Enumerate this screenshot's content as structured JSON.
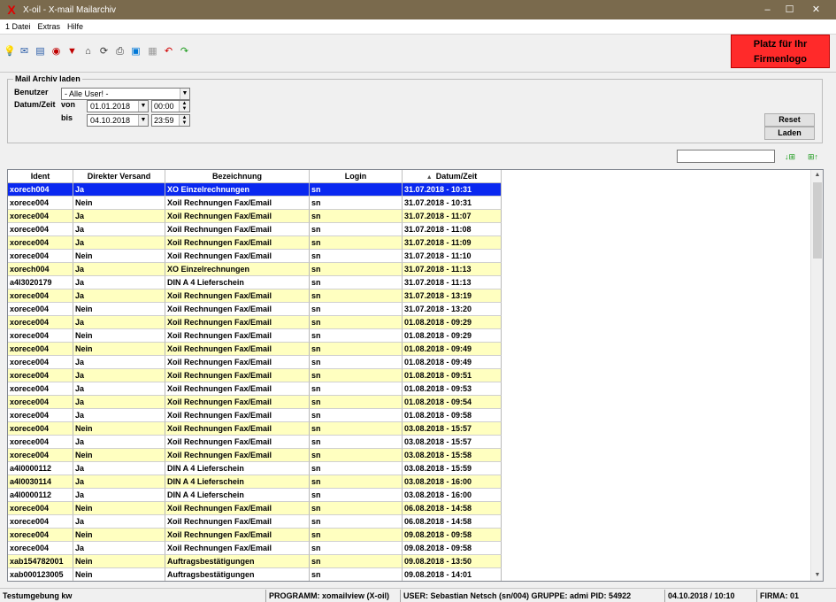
{
  "window": {
    "app_icon": "X",
    "title": "X-oil - X-mail Mailarchiv",
    "controls": [
      "–",
      "☐",
      "✕"
    ]
  },
  "menu": {
    "items": [
      "1 Datei",
      "Extras",
      "Hilfe"
    ]
  },
  "toolbar": {
    "icons": [
      "lightbulb-icon",
      "mail-icon",
      "book-icon",
      "database-icon",
      "filter-icon",
      "home-icon",
      "refresh-icon",
      "print-icon",
      "window-icon",
      "save-icon",
      "undo-icon",
      "redo-icon"
    ],
    "logo_line1": "Platz für Ihr",
    "logo_line2": "Firmenlogo"
  },
  "filter": {
    "group_title": "Mail Archiv laden",
    "benutzer_label": "Benutzer",
    "benutzer_value": "- Alle User! -",
    "datum_label": "Datum/Zeit",
    "von_label": "von",
    "bis_label": "bis",
    "von_date": "01.01.2018",
    "von_time": "00:00",
    "bis_date": "04.10.2018",
    "bis_time": "23:59",
    "reset_label": "Reset",
    "laden_label": "Laden"
  },
  "search": {
    "value": ""
  },
  "table": {
    "columns": [
      "Ident",
      "Direkter Versand",
      "Bezeichnung",
      "Login",
      "Datum/Zeit"
    ],
    "sort_indicator": "▲",
    "rows": [
      [
        "xorech004",
        "Ja",
        "XO Einzelrechnungen",
        "sn",
        "31.07.2018 - 10:31"
      ],
      [
        "xorece004",
        "Nein",
        "Xoil Rechnungen Fax/Email",
        "sn",
        "31.07.2018 - 10:31"
      ],
      [
        "xorece004",
        "Ja",
        "Xoil Rechnungen Fax/Email",
        "sn",
        "31.07.2018 - 11:07"
      ],
      [
        "xorece004",
        "Ja",
        "Xoil Rechnungen Fax/Email",
        "sn",
        "31.07.2018 - 11:08"
      ],
      [
        "xorece004",
        "Ja",
        "Xoil Rechnungen Fax/Email",
        "sn",
        "31.07.2018 - 11:09"
      ],
      [
        "xorece004",
        "Nein",
        "Xoil Rechnungen Fax/Email",
        "sn",
        "31.07.2018 - 11:10"
      ],
      [
        "xorech004",
        "Ja",
        "XO Einzelrechnungen",
        "sn",
        "31.07.2018 - 11:13"
      ],
      [
        "a4l3020179",
        "Ja",
        "DIN A 4 Lieferschein",
        "sn",
        "31.07.2018 - 11:13"
      ],
      [
        "xorece004",
        "Ja",
        "Xoil Rechnungen Fax/Email",
        "sn",
        "31.07.2018 - 13:19"
      ],
      [
        "xorece004",
        "Nein",
        "Xoil Rechnungen Fax/Email",
        "sn",
        "31.07.2018 - 13:20"
      ],
      [
        "xorece004",
        "Ja",
        "Xoil Rechnungen Fax/Email",
        "sn",
        "01.08.2018 - 09:29"
      ],
      [
        "xorece004",
        "Nein",
        "Xoil Rechnungen Fax/Email",
        "sn",
        "01.08.2018 - 09:29"
      ],
      [
        "xorece004",
        "Nein",
        "Xoil Rechnungen Fax/Email",
        "sn",
        "01.08.2018 - 09:49"
      ],
      [
        "xorece004",
        "Ja",
        "Xoil Rechnungen Fax/Email",
        "sn",
        "01.08.2018 - 09:49"
      ],
      [
        "xorece004",
        "Ja",
        "Xoil Rechnungen Fax/Email",
        "sn",
        "01.08.2018 - 09:51"
      ],
      [
        "xorece004",
        "Ja",
        "Xoil Rechnungen Fax/Email",
        "sn",
        "01.08.2018 - 09:53"
      ],
      [
        "xorece004",
        "Ja",
        "Xoil Rechnungen Fax/Email",
        "sn",
        "01.08.2018 - 09:54"
      ],
      [
        "xorece004",
        "Ja",
        "Xoil Rechnungen Fax/Email",
        "sn",
        "01.08.2018 - 09:58"
      ],
      [
        "xorece004",
        "Nein",
        "Xoil Rechnungen Fax/Email",
        "sn",
        "03.08.2018 - 15:57"
      ],
      [
        "xorece004",
        "Ja",
        "Xoil Rechnungen Fax/Email",
        "sn",
        "03.08.2018 - 15:57"
      ],
      [
        "xorece004",
        "Nein",
        "Xoil Rechnungen Fax/Email",
        "sn",
        "03.08.2018 - 15:58"
      ],
      [
        "a4l0000112",
        "Ja",
        "DIN A 4 Lieferschein",
        "sn",
        "03.08.2018 - 15:59"
      ],
      [
        "a4l0030114",
        "Ja",
        "DIN A 4 Lieferschein",
        "sn",
        "03.08.2018 - 16:00"
      ],
      [
        "a4l0000112",
        "Ja",
        "DIN A 4 Lieferschein",
        "sn",
        "03.08.2018 - 16:00"
      ],
      [
        "xorece004",
        "Nein",
        "Xoil Rechnungen Fax/Email",
        "sn",
        "06.08.2018 - 14:58"
      ],
      [
        "xorece004",
        "Ja",
        "Xoil Rechnungen Fax/Email",
        "sn",
        "06.08.2018 - 14:58"
      ],
      [
        "xorece004",
        "Nein",
        "Xoil Rechnungen Fax/Email",
        "sn",
        "09.08.2018 - 09:58"
      ],
      [
        "xorece004",
        "Ja",
        "Xoil Rechnungen Fax/Email",
        "sn",
        "09.08.2018 - 09:58"
      ],
      [
        "xab154782001",
        "Nein",
        "Auftragsbestätigungen",
        "sn",
        "09.08.2018 - 13:50"
      ],
      [
        "xab000123005",
        "Nein",
        "Auftragsbestätigungen",
        "sn",
        "09.08.2018 - 14:01"
      ]
    ],
    "selected_row": 0
  },
  "status": {
    "env": "Testumgebung kw",
    "programm": "PROGRAMM: xomailview (X-oil)",
    "user": "USER: Sebastian Netsch (sn/004)  GRUPPE: admi  PID: 54922",
    "datetime": "04.10.2018 / 10:10",
    "firma": "FIRMA: 01"
  },
  "colors": {
    "titlebar": "#7a6a4d",
    "selection": "#0a28f0",
    "row_alt": "#ffffc0",
    "logo_bg": "#ff2a2a"
  }
}
